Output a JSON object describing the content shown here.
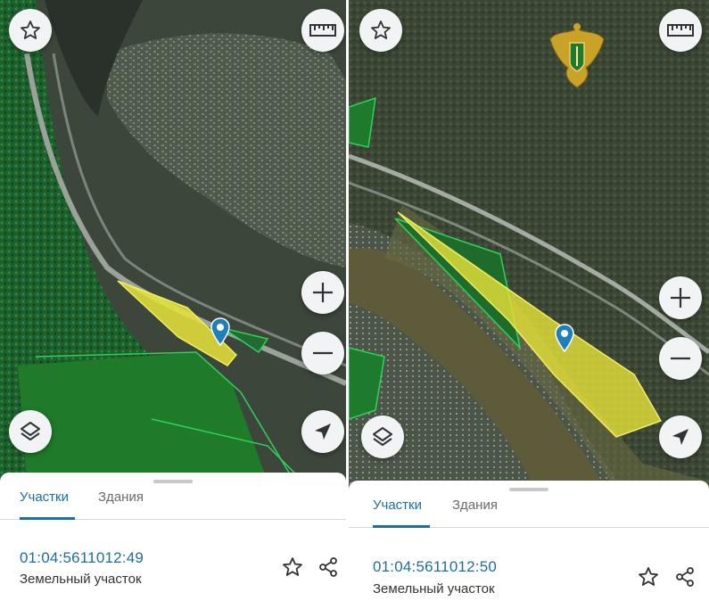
{
  "screens": [
    {
      "tabs": {
        "parcels": "Участки",
        "buildings": "Здания"
      },
      "active_tab": "parcels",
      "parcel": {
        "id": "01:04:5611012:49",
        "type": "Земельный участок"
      }
    },
    {
      "tabs": {
        "parcels": "Участки",
        "buildings": "Здания"
      },
      "active_tab": "parcels",
      "parcel": {
        "id": "01:04:5611012:50",
        "type": "Земельный участок"
      }
    }
  ],
  "colors": {
    "accent": "#1b6f9c",
    "parcel_fill": "#e8e43a",
    "pin": "#1f7fb8",
    "zone_outline": "#2fd35a"
  },
  "icons": [
    "star-icon",
    "ruler-icon",
    "plus-icon",
    "minus-icon",
    "layers-icon",
    "locate-arrow-icon",
    "share-icon",
    "map-pin-icon",
    "emblem-icon"
  ]
}
